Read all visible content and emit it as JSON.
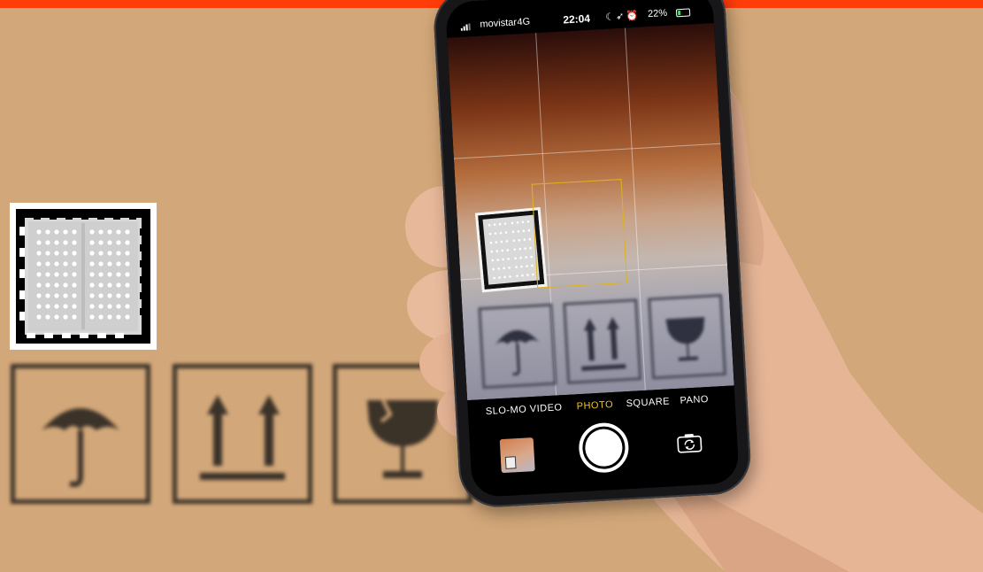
{
  "scene": {
    "background_color": "#d2a779",
    "accent_bar_color": "#ff3c0a"
  },
  "box_symbols": [
    {
      "name": "umbrella-icon"
    },
    {
      "name": "this-way-up-icon"
    },
    {
      "name": "fragile-glass-icon"
    }
  ],
  "phone": {
    "status": {
      "carrier": "movistar",
      "network": "4G",
      "time": "22:04",
      "battery": "22%"
    },
    "camera": {
      "modes": [
        "SLO-MO",
        "VIDEO",
        "PHOTO",
        "SQUARE",
        "PANO"
      ],
      "active_mode": "PHOTO",
      "focus_color": "#e0b21f"
    }
  }
}
